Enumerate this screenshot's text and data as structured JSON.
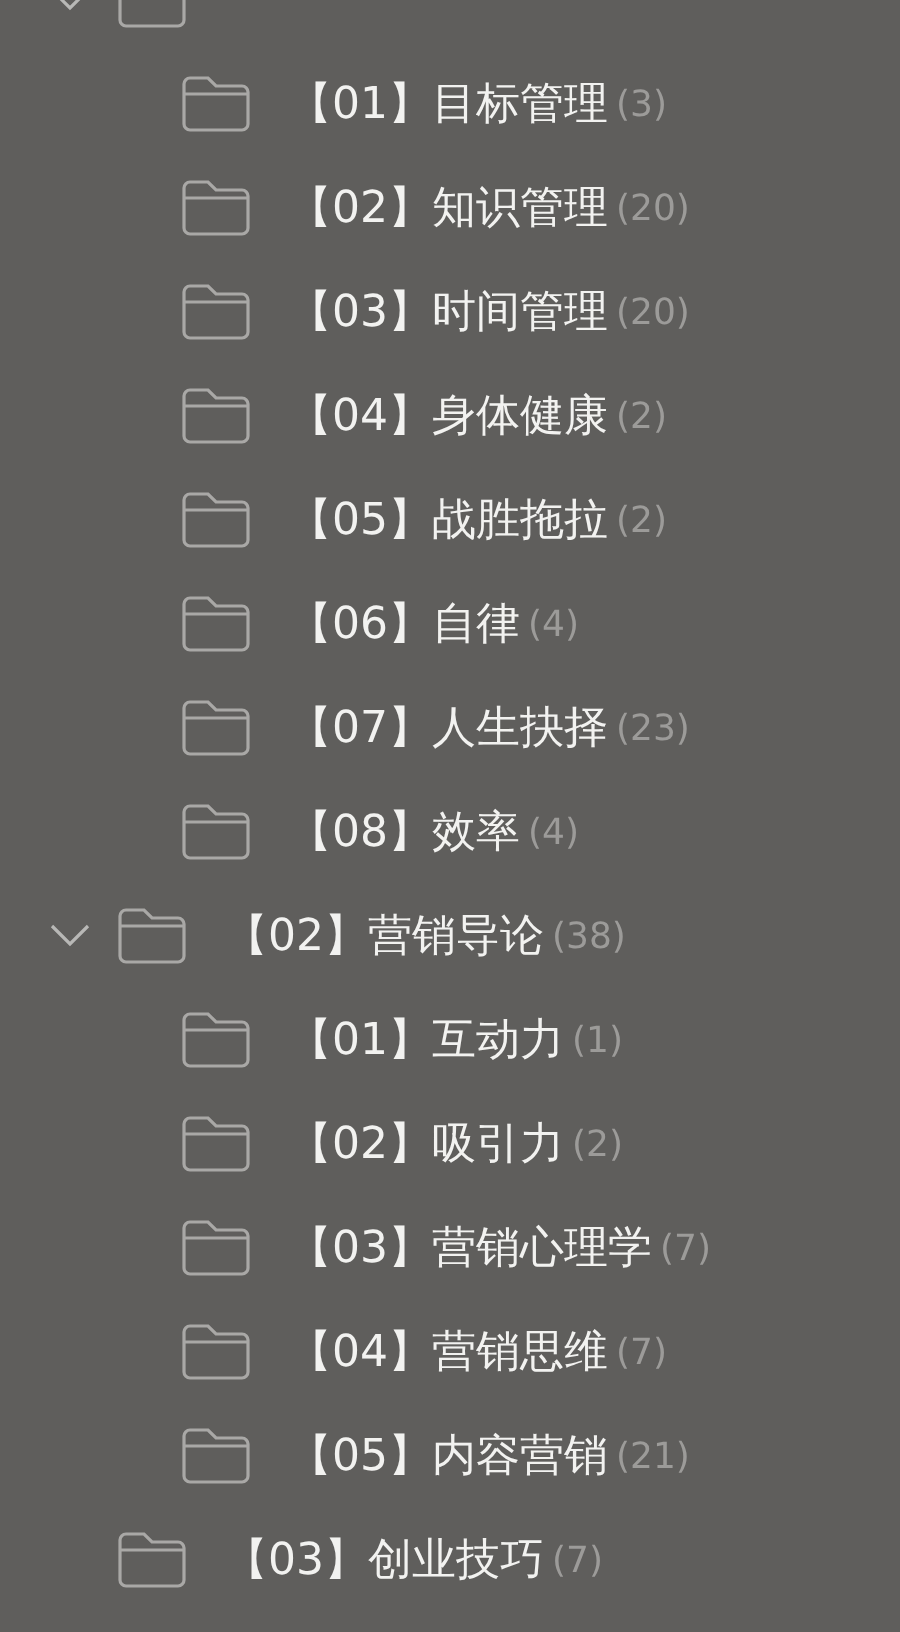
{
  "tree": [
    {
      "expanded": true,
      "children": [
        {
          "label": "【01】目标管理",
          "count": "(3)"
        },
        {
          "label": "【02】知识管理",
          "count": "(20)"
        },
        {
          "label": "【03】时间管理",
          "count": "(20)"
        },
        {
          "label": "【04】身体健康",
          "count": "(2)"
        },
        {
          "label": "【05】战胜拖拉",
          "count": "(2)"
        },
        {
          "label": "【06】自律",
          "count": "(4)"
        },
        {
          "label": "【07】人生抉择",
          "count": "(23)"
        },
        {
          "label": "【08】效率",
          "count": "(4)"
        }
      ]
    },
    {
      "label": "【02】营销导论",
      "count": "(38)",
      "expanded": true,
      "children": [
        {
          "label": "【01】互动力",
          "count": "(1)"
        },
        {
          "label": "【02】吸引力",
          "count": "(2)"
        },
        {
          "label": "【03】营销心理学",
          "count": "(7)"
        },
        {
          "label": "【04】营销思维",
          "count": "(7)"
        },
        {
          "label": "【05】内容营销",
          "count": "(21)"
        }
      ]
    },
    {
      "label": "【03】创业技巧",
      "count": "(7)"
    }
  ]
}
